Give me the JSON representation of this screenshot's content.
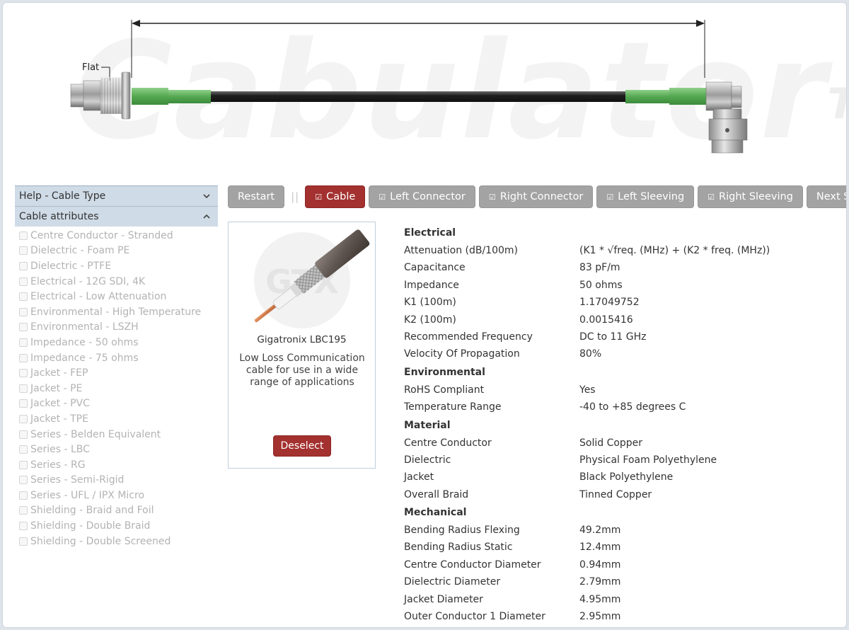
{
  "hero": {
    "watermark": "Cabulator",
    "watermark_tm": "TM",
    "flat_label": "Flat"
  },
  "sidebar": {
    "help_header": "Help - Cable Type",
    "attributes_header": "Cable attributes",
    "filters": [
      "Centre Conductor - Stranded",
      "Dielectric - Foam PE",
      "Dielectric - PTFE",
      "Electrical - 12G SDI, 4K",
      "Electrical - Low Attenuation",
      "Environmental - High Temperature",
      "Environmental - LSZH",
      "Impedance - 50 ohms",
      "Impedance - 75 ohms",
      "Jacket - FEP",
      "Jacket - PE",
      "Jacket - PVC",
      "Jacket - TPE",
      "Series - Belden Equivalent",
      "Series - LBC",
      "Series - RG",
      "Series - Semi-Rigid",
      "Series - UFL / IPX Micro",
      "Shielding - Braid and Foil",
      "Shielding - Double Braid",
      "Shielding - Double Screened"
    ]
  },
  "toolbar": {
    "restart": "Restart",
    "separator": "||",
    "cable": "Cable",
    "left_connector": "Left Connector",
    "right_connector": "Right Connector",
    "left_sleeving": "Left Sleeving",
    "right_sleeving": "Right Sleeving",
    "next_step": "Next Step ▶",
    "tick": "☑"
  },
  "card": {
    "logo_text": "GTX",
    "name": "Gigatronix LBC195",
    "description": "Low Loss Communication cable for use in a wide range of applications",
    "deselect": "Deselect"
  },
  "specs": [
    {
      "title": "Electrical",
      "rows": [
        {
          "label": "Attenuation (dB/100m)",
          "value": "(K1 * √freq. (MHz) + (K2 * freq. (MHz))"
        },
        {
          "label": "Capacitance",
          "value": "83 pF/m"
        },
        {
          "label": "Impedance",
          "value": "50 ohms"
        },
        {
          "label": "K1 (100m)",
          "value": "1.17049752"
        },
        {
          "label": "K2 (100m)",
          "value": "0.0015416"
        },
        {
          "label": "Recommended Frequency",
          "value": "DC to 11 GHz"
        },
        {
          "label": "Velocity Of Propagation",
          "value": "80%"
        }
      ]
    },
    {
      "title": "Environmental",
      "rows": [
        {
          "label": "RoHS Compliant",
          "value": "Yes"
        },
        {
          "label": "Temperature Range",
          "value": "-40 to +85 degrees C"
        }
      ]
    },
    {
      "title": "Material",
      "rows": [
        {
          "label": "Centre Conductor",
          "value": "Solid Copper"
        },
        {
          "label": "Dielectric",
          "value": "Physical Foam Polyethylene"
        },
        {
          "label": "Jacket",
          "value": "Black Polyethylene"
        },
        {
          "label": "Overall Braid",
          "value": "Tinned Copper"
        }
      ]
    },
    {
      "title": "Mechanical",
      "rows": [
        {
          "label": "Bending Radius Flexing",
          "value": "49.2mm"
        },
        {
          "label": "Bending Radius Static",
          "value": "12.4mm"
        },
        {
          "label": "Centre Conductor Diameter",
          "value": "0.94mm"
        },
        {
          "label": "Dielectric Diameter",
          "value": "2.79mm"
        },
        {
          "label": "Jacket Diameter",
          "value": "4.95mm"
        },
        {
          "label": "Outer Conductor 1 Diameter",
          "value": "2.95mm"
        }
      ]
    }
  ],
  "colors": {
    "accent_red": "#a3312f",
    "button_grey": "#a3a3a3",
    "sleeve_green": "#5fae5c",
    "header_blue": "#cfdbe6"
  }
}
